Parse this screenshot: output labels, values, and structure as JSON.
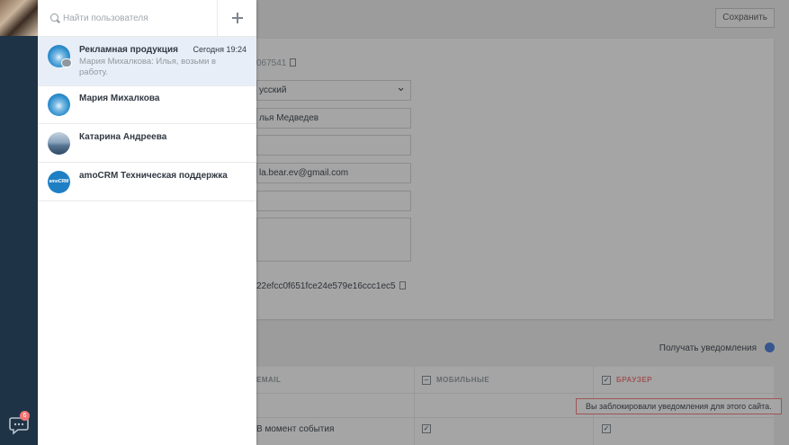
{
  "sidebar": {
    "chat_badge": "6"
  },
  "settings": {
    "save_label": "Сохранить",
    "user_id": "067541",
    "language": "усский",
    "name": "лья Медведев",
    "email": "la.bear.ev@gmail.com",
    "api_key": "22efcc0f651fce24e579e16ccc1ec5",
    "notifications_label": "Получать уведомления",
    "table": {
      "col_email": "EMAIL",
      "col_mobile": "МОБИЛЬНЫЕ",
      "col_browser": "БРАУЗЕР",
      "blocked_warning": "Вы заблокировали уведомления для этого сайта.",
      "row_label": "В момент события"
    }
  },
  "chat": {
    "search_placeholder": "Найти пользователя",
    "items": [
      {
        "name": "Рекламная продукция",
        "time": "Сегодня 19:24",
        "preview": "Мария Михалкова: Илья, возьми в работу."
      },
      {
        "name": "Мария Михалкова"
      },
      {
        "name": "Катарина Андреева"
      },
      {
        "name": "amoCRM Техническая поддержка",
        "avatar_text": "amoCRM"
      }
    ]
  }
}
